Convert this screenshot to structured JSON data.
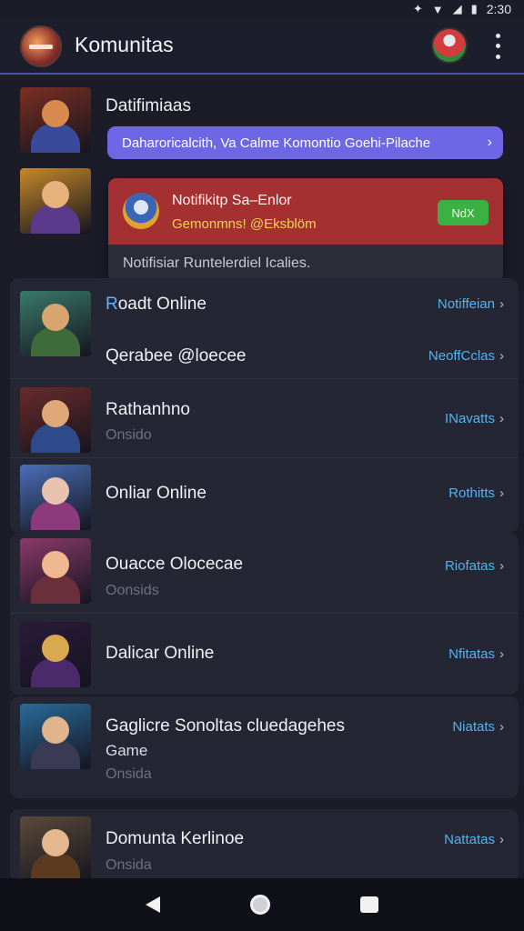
{
  "status_bar": {
    "time": "2:30",
    "icons": [
      "signal-icon",
      "wifi-icon",
      "cell-icon",
      "battery-icon"
    ]
  },
  "app_bar": {
    "title": "Komunitas",
    "logo_icon": "app-logo-icon",
    "profile_icon": "profile-avatar-icon",
    "menu_icon": "more-vert-icon"
  },
  "top_item": {
    "title": "Datifimiaas",
    "promo": {
      "text": "Daharoricalcith, Va Calme Komontio Goehi-Pilache",
      "chevron": "›"
    }
  },
  "notification": {
    "title": "Notifikitp Sa–Enlor",
    "subtitle": "Gemonmns! @Eksblöm",
    "button": "NdX",
    "body": "Notifisiar Runtelerdiel Icalies."
  },
  "list": [
    {
      "title_prefix": "R",
      "title_rest": "oadt Online",
      "action": "Notiffeian",
      "sub_title": "Qerabee @loecee",
      "sub_action": "NeoffCclas",
      "colors": {
        "bg": "#3a7a6c",
        "body": "#3f6b3a",
        "face": "#d9a56f"
      }
    },
    {
      "title": "Rathanhno",
      "sub": "Onsido",
      "action": "INavatts",
      "colors": {
        "bg": "#6a2a2a",
        "body": "#2f4a8a",
        "face": "#e0a878"
      }
    },
    {
      "title": "Onliar Online",
      "action": "Rothitts",
      "colors": {
        "bg": "#4a6fb8",
        "body": "#8b3a7a",
        "face": "#e8c4b0"
      }
    },
    {
      "title": "Ouacce Olocecae",
      "sub": "Oonsids",
      "action": "Riofatas",
      "colors": {
        "bg": "#8a3a6a",
        "body": "#6a2f3a",
        "face": "#f0b890"
      }
    },
    {
      "title": "Dalicar Online",
      "action": "Nfitatas",
      "colors": {
        "bg": "#2a1a3a",
        "body": "#4a2a6a",
        "face": "#d9a94f"
      }
    },
    {
      "title": "Gaglicre Sonoltas cluedagehes",
      "sub2": "Game",
      "sub": "Onsida",
      "action": "Niatats",
      "colors": {
        "bg": "#2a6a9a",
        "body": "#3a3a55",
        "face": "#e0b48c"
      }
    },
    {
      "title": "Domunta Kerlinoe",
      "sub": "Onsida",
      "action": "Nattatas",
      "colors": {
        "bg": "#5a4a3a",
        "body": "#5c3a22",
        "face": "#e4b88e"
      }
    }
  ],
  "top_thumbs": [
    {
      "bg": "#7a2f22",
      "body": "#3a4a9a",
      "face": "#d98a4f"
    },
    {
      "bg": "#c6882a",
      "body": "#5a3a8a",
      "face": "#e6b17a"
    }
  ],
  "nav_bar": {
    "icons": [
      "back-icon",
      "home-icon",
      "recents-icon"
    ]
  },
  "colors": {
    "accent": "#6d67e6",
    "link": "#4fb4f4",
    "notif_red": "#a43032",
    "notif_button": "#3bb144"
  }
}
